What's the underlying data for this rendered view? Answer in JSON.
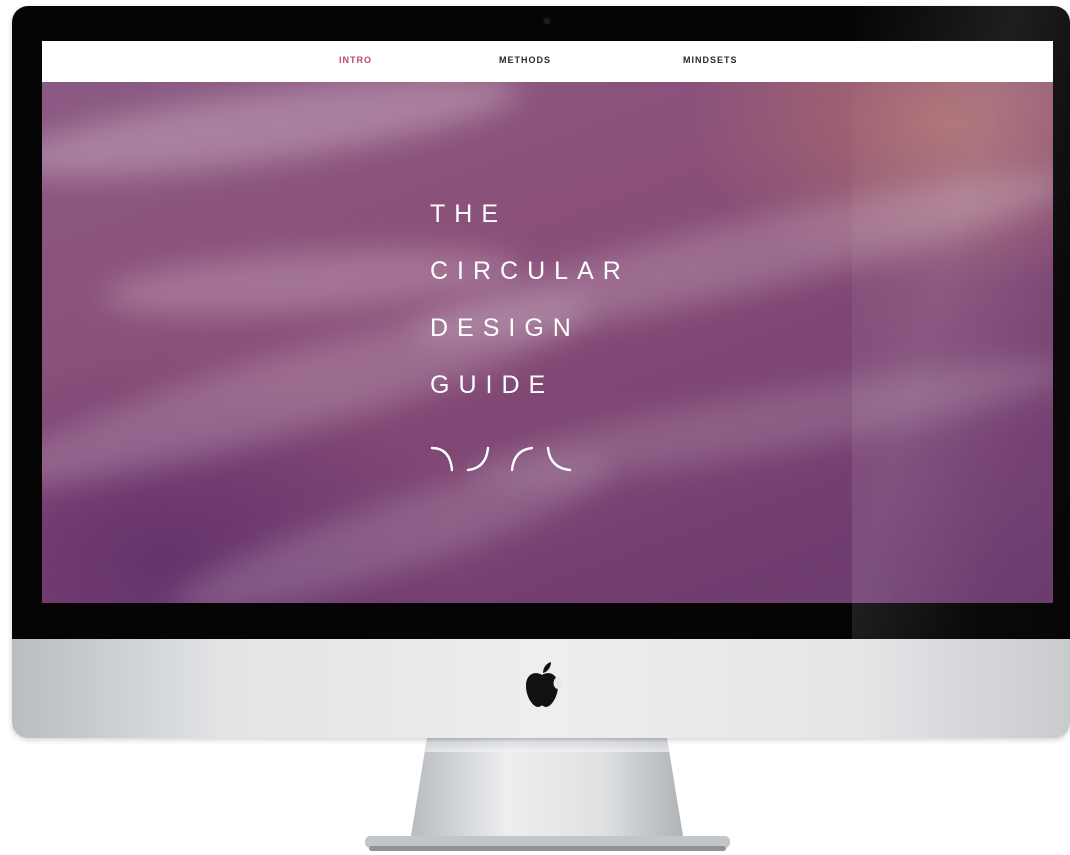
{
  "nav": {
    "items": [
      {
        "label": "INTRO",
        "active": true
      },
      {
        "label": "METHODS",
        "active": false
      },
      {
        "label": "MINDSETS",
        "active": false
      }
    ],
    "active_color": "#c2466d"
  },
  "hero": {
    "title_lines": [
      "THE",
      "CIRCULAR",
      "DESIGN",
      "GUIDE"
    ],
    "mark_icon": "four-arcs-icon",
    "text_color": "#ffffff"
  },
  "device": {
    "logo_icon": "apple-logo-icon"
  }
}
